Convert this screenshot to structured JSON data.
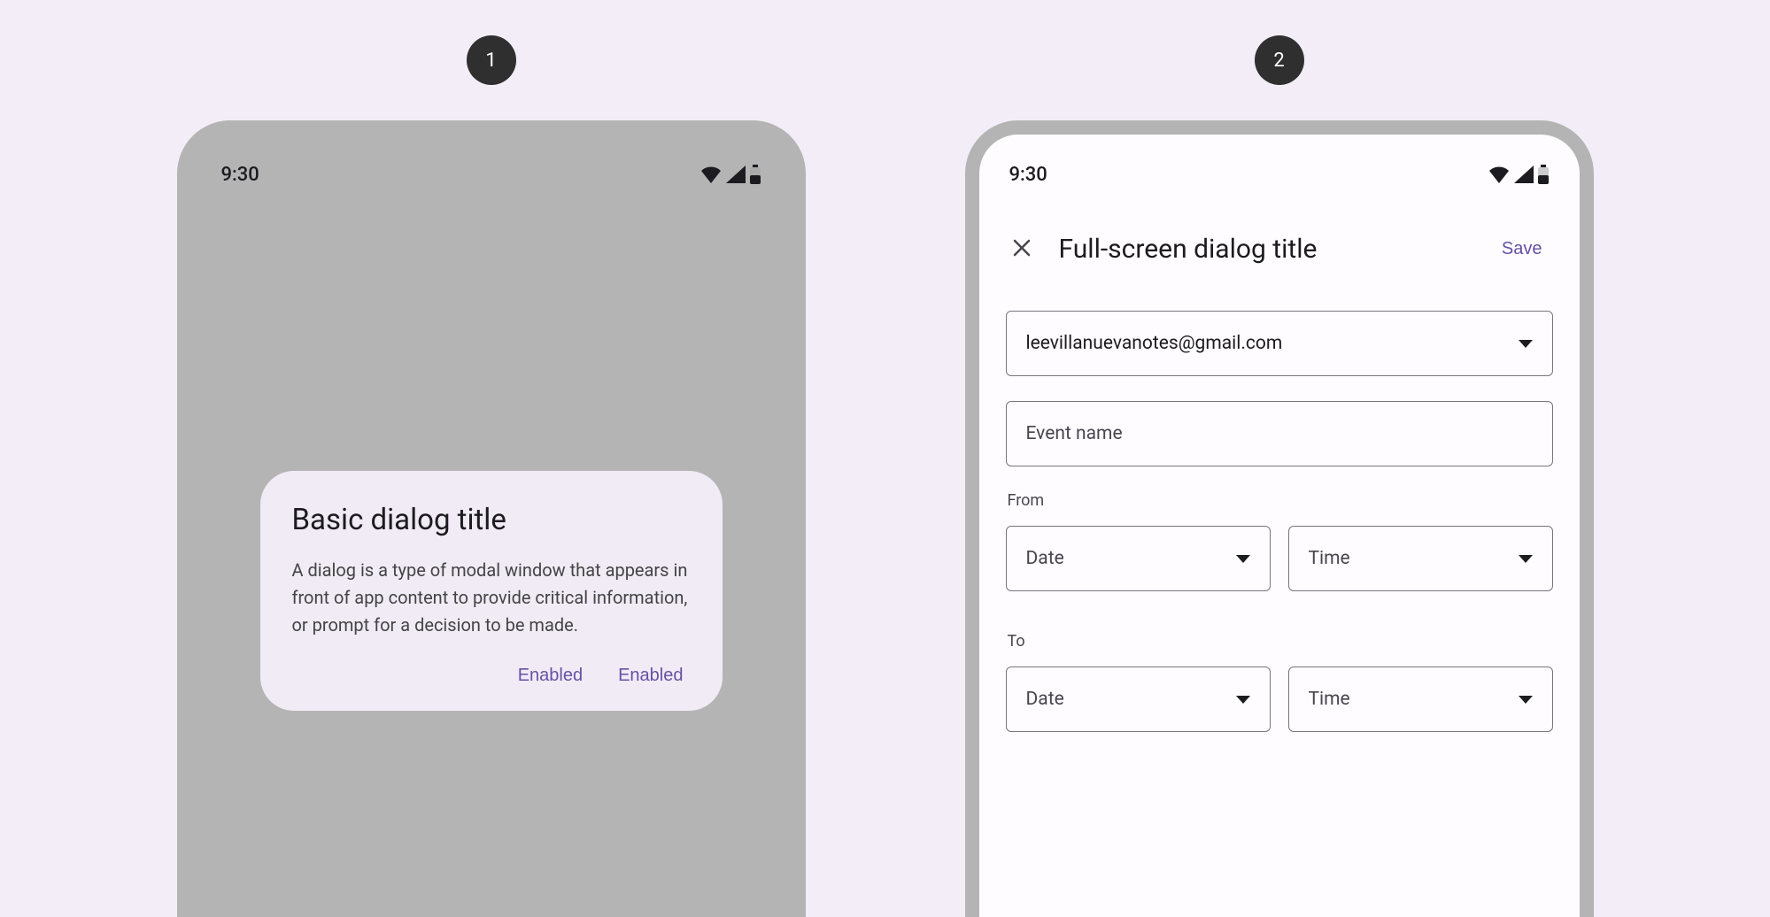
{
  "badges": {
    "one": "1",
    "two": "2"
  },
  "status": {
    "time": "9:30"
  },
  "basic_dialog": {
    "title": "Basic dialog title",
    "body": "A dialog is a type of modal window that appears in front of app content to provide critical information, or prompt for a decision to be made.",
    "action1": "Enabled",
    "action2": "Enabled"
  },
  "fullscreen_dialog": {
    "title": "Full-screen dialog title",
    "save": "Save",
    "email": "leevillanuevanotes@gmail.com",
    "event_placeholder": "Event name",
    "from_label": "From",
    "to_label": "To",
    "date_label": "Date",
    "time_label": "Time"
  }
}
